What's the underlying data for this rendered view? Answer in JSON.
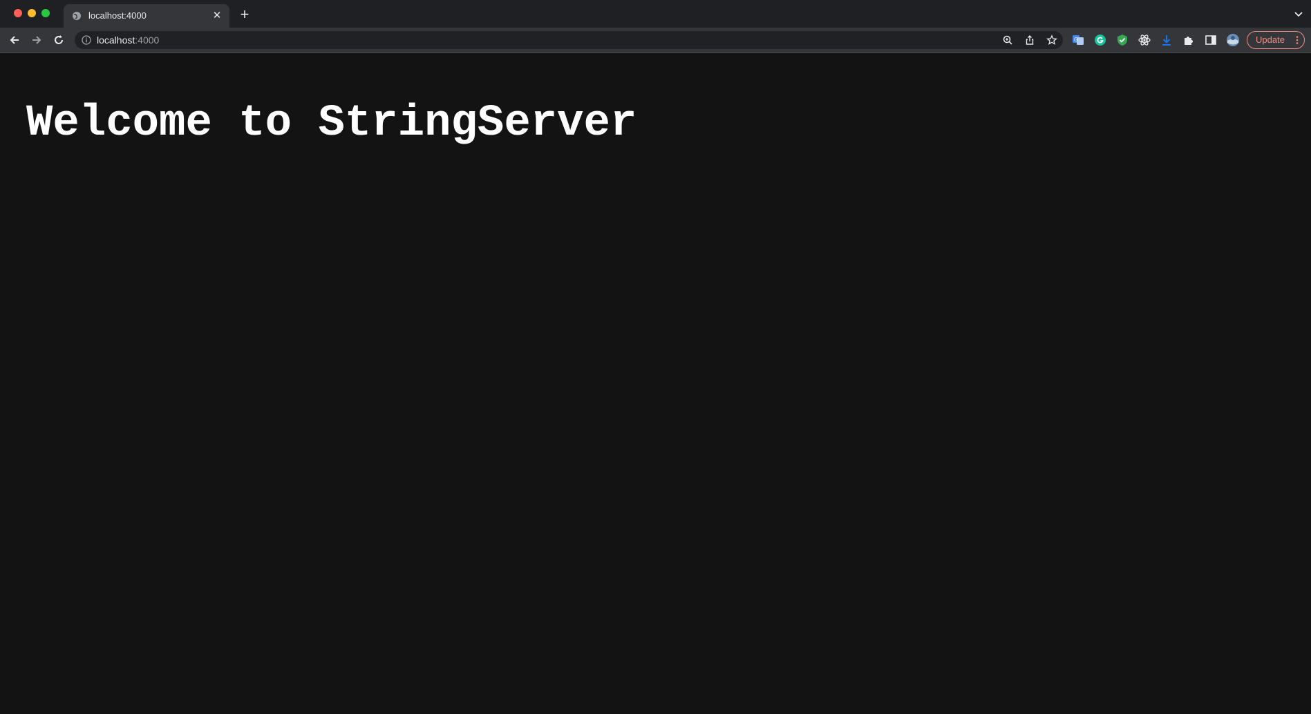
{
  "browser": {
    "tab": {
      "title": "localhost:4000"
    },
    "omnibox": {
      "host": "localhost",
      "port": ":4000"
    },
    "update_label": "Update"
  },
  "page": {
    "heading": "Welcome to StringServer"
  },
  "colors": {
    "background": "#131314",
    "heading": "#ffffff",
    "update_accent": "#f28b82"
  }
}
